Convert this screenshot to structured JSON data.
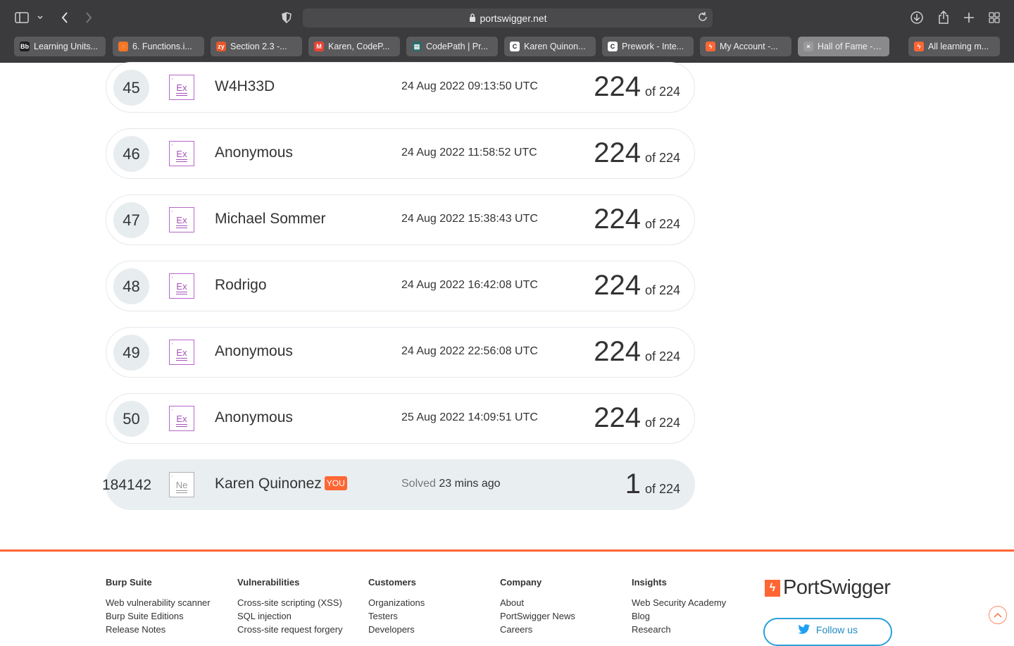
{
  "browser": {
    "url": "portswigger.net",
    "tabs": [
      {
        "label": "Learning Units...",
        "icon": "blackboard-icon",
        "color": "#1f1f1f",
        "fav": "Bb"
      },
      {
        "label": "6. Functions.i...",
        "icon": "jupyter-icon",
        "color": "#f37726",
        "fav": "◌"
      },
      {
        "label": "Section 2.3 -...",
        "icon": "zybooks-icon",
        "color": "#e8562a",
        "fav": "zy"
      },
      {
        "label": "Karen, CodeP...",
        "icon": "gmail-icon",
        "color": "#ea4335",
        "fav": "M"
      },
      {
        "label": "CodePath | Pr...",
        "icon": "codepath-icon",
        "color": "#2d6a6a",
        "fav": "▤"
      },
      {
        "label": "Karen Quinon...",
        "icon": "codepath-c-icon",
        "color": "#ffffff",
        "fav": "C"
      },
      {
        "label": "Prework - Inte...",
        "icon": "codepath-c-icon",
        "color": "#ffffff",
        "fav": "C"
      },
      {
        "label": "My Account -...",
        "icon": "portswigger-icon",
        "color": "#ff6633",
        "fav": "ϟ"
      },
      {
        "label": "Hall of Fame - W...",
        "icon": "portswigger-icon",
        "color": "#9a9a9a",
        "fav": "×"
      },
      {
        "label": "All learning m...",
        "icon": "portswigger-icon",
        "color": "#ff6633",
        "fav": "ϟ"
      }
    ]
  },
  "leaderboard": [
    {
      "rank": "45",
      "level": "Ex",
      "name": "W4H33D",
      "date": "24 Aug 2022 09:13:50 UTC",
      "solved": "224",
      "of": "of 224"
    },
    {
      "rank": "46",
      "level": "Ex",
      "name": "Anonymous",
      "date": "24 Aug 2022 11:58:52 UTC",
      "solved": "224",
      "of": "of 224"
    },
    {
      "rank": "47",
      "level": "Ex",
      "name": "Michael Sommer",
      "date": "24 Aug 2022 15:38:43 UTC",
      "solved": "224",
      "of": "of 224"
    },
    {
      "rank": "48",
      "level": "Ex",
      "name": "Rodrigo",
      "date": "24 Aug 2022 16:42:08 UTC",
      "solved": "224",
      "of": "of 224"
    },
    {
      "rank": "49",
      "level": "Ex",
      "name": "Anonymous",
      "date": "24 Aug 2022 22:56:08 UTC",
      "solved": "224",
      "of": "of 224"
    },
    {
      "rank": "50",
      "level": "Ex",
      "name": "Anonymous",
      "date": "25 Aug 2022 14:09:51 UTC",
      "solved": "224",
      "of": "of 224"
    }
  ],
  "you": {
    "rank": "184142",
    "level": "Ne",
    "name": "Karen Quinonez",
    "tag": "YOU",
    "solved_label": "Solved",
    "date": "23 mins ago",
    "solved": "1",
    "of": "of 224"
  },
  "footer": {
    "columns": [
      {
        "heading": "Burp Suite",
        "links": [
          "Web vulnerability scanner",
          "Burp Suite Editions",
          "Release Notes"
        ]
      },
      {
        "heading": "Vulnerabilities",
        "links": [
          "Cross-site scripting (XSS)",
          "SQL injection",
          "Cross-site request forgery"
        ]
      },
      {
        "heading": "Customers",
        "links": [
          "Organizations",
          "Testers",
          "Developers"
        ]
      },
      {
        "heading": "Company",
        "links": [
          "About",
          "PortSwigger News",
          "Careers"
        ]
      },
      {
        "heading": "Insights",
        "links": [
          "Web Security Academy",
          "Blog",
          "Research"
        ]
      }
    ],
    "logo_text": "PortSwigger",
    "follow_label": "Follow us",
    "accent": "#ff6633"
  }
}
